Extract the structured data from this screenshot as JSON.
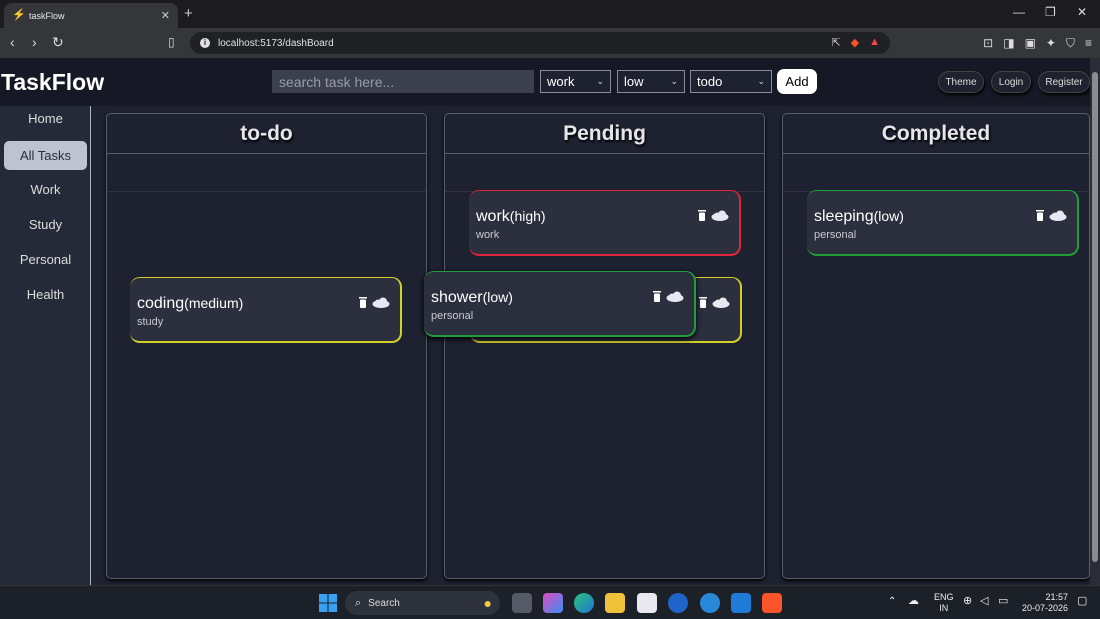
{
  "browser": {
    "tab_title": "taskFlow",
    "url": "localhost:5173/dashBoard"
  },
  "header": {
    "logo": "TaskFlow",
    "search_placeholder": "search task here...",
    "category_select": "work",
    "priority_select": "low",
    "status_select": "todo",
    "add_label": "Add",
    "theme_label": "Theme",
    "login_label": "Login",
    "register_label": "Register"
  },
  "sidebar": {
    "items": [
      {
        "label": "Home"
      },
      {
        "label": "All Tasks"
      },
      {
        "label": "Work"
      },
      {
        "label": "Study"
      },
      {
        "label": "Personal"
      },
      {
        "label": "Health"
      }
    ]
  },
  "columns": [
    {
      "title": "to-do"
    },
    {
      "title": "Pending"
    },
    {
      "title": "Completed"
    }
  ],
  "cards": {
    "coding": {
      "name": "coding",
      "priority": "(medium)",
      "category": "study",
      "border": "#d4d02a"
    },
    "work": {
      "name": "work",
      "priority": "(high)",
      "category": "work",
      "border": "#e0243a"
    },
    "shower": {
      "name": "shower",
      "priority": "(low)",
      "category": "personal",
      "border": "#1f9e3a"
    },
    "hidden": {
      "border": "#d4d02a"
    },
    "sleeping": {
      "name": "sleeping",
      "priority": "(low)",
      "category": "personal",
      "border": "#1f9e3a"
    }
  },
  "taskbar": {
    "search_label": "Search",
    "lang_top": "ENG",
    "lang_bottom": "IN",
    "time": "21:57",
    "date": "20-07-2026"
  }
}
